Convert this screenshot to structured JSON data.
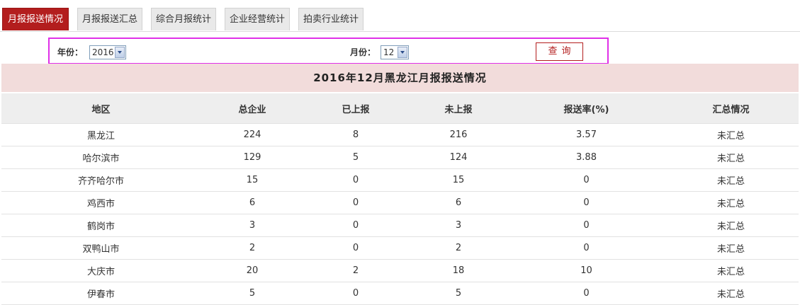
{
  "tabs": [
    {
      "label": "月报报送情况",
      "active": true
    },
    {
      "label": "月报报送汇总",
      "active": false
    },
    {
      "label": "综合月报统计",
      "active": false
    },
    {
      "label": "企业经营统计",
      "active": false
    },
    {
      "label": "拍卖行业统计",
      "active": false
    }
  ],
  "query": {
    "year_label": "年份：",
    "year_value": "2016",
    "month_label": "月份：",
    "month_value": "12",
    "search_button": "查询"
  },
  "report_title": "2016年12月黑龙江月报报送情况",
  "table": {
    "headers": [
      "地区",
      "总企业",
      "已上报",
      "未上报",
      "报送率(%)",
      "汇总情况"
    ],
    "rows": [
      [
        "黑龙江",
        "224",
        "8",
        "216",
        "3.57",
        "未汇总"
      ],
      [
        "哈尔滨市",
        "129",
        "5",
        "124",
        "3.88",
        "未汇总"
      ],
      [
        "齐齐哈尔市",
        "15",
        "0",
        "15",
        "0",
        "未汇总"
      ],
      [
        "鸡西市",
        "6",
        "0",
        "6",
        "0",
        "未汇总"
      ],
      [
        "鹤岗市",
        "3",
        "0",
        "3",
        "0",
        "未汇总"
      ],
      [
        "双鸭山市",
        "2",
        "0",
        "2",
        "0",
        "未汇总"
      ],
      [
        "大庆市",
        "20",
        "2",
        "18",
        "10",
        "未汇总"
      ],
      [
        "伊春市",
        "5",
        "0",
        "5",
        "0",
        "未汇总"
      ]
    ]
  },
  "colors": {
    "accent": "#b31e1e",
    "title_background": "#f2dcdb",
    "query_highlight_border": "#e030e8"
  }
}
